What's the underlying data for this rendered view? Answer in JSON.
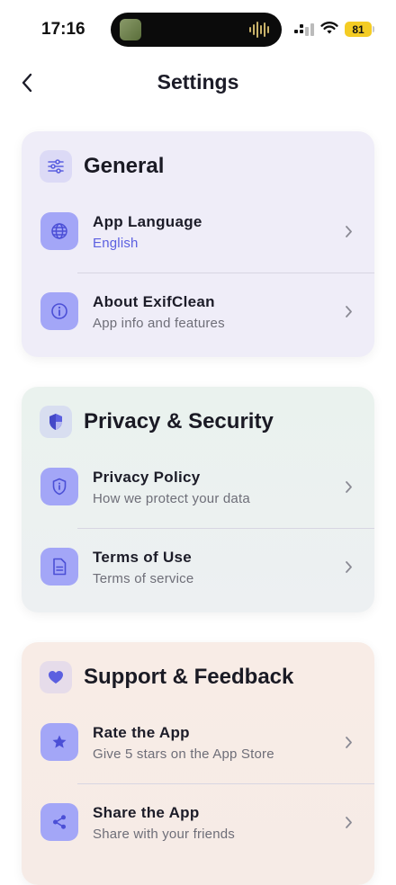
{
  "status_bar": {
    "time": "17:16",
    "battery": "81",
    "battery_color": "#f4cc24"
  },
  "nav": {
    "back_icon": "chevron-left-icon",
    "title": "Settings"
  },
  "sections": [
    {
      "title": "General",
      "icon": "sliders-icon",
      "items": [
        {
          "title": "App Language",
          "subtitle": "English",
          "icon": "globe-icon",
          "subtitle_color": "#5b5fe0"
        },
        {
          "title": "About ExifClean",
          "subtitle": "App info and features",
          "icon": "info-icon"
        }
      ]
    },
    {
      "title": "Privacy & Security",
      "icon": "shield-icon",
      "items": [
        {
          "title": "Privacy Policy",
          "subtitle": "How we protect your data",
          "icon": "shield-info-icon"
        },
        {
          "title": "Terms of Use",
          "subtitle": "Terms of service",
          "icon": "document-icon"
        }
      ]
    },
    {
      "title": "Support & Feedback",
      "icon": "heart-icon",
      "items": [
        {
          "title": "Rate the App",
          "subtitle": "Give 5 stars on the App Store",
          "icon": "star-icon"
        },
        {
          "title": "Share the App",
          "subtitle": "Share with your friends",
          "icon": "share-icon"
        }
      ]
    }
  ],
  "colors": {
    "accent": "#5b5fe0",
    "icon_tile": "#a3a6f7",
    "general_card": "#efedf8",
    "privacy_card": "#eaf2ee",
    "support_card": "#f8ece6"
  }
}
